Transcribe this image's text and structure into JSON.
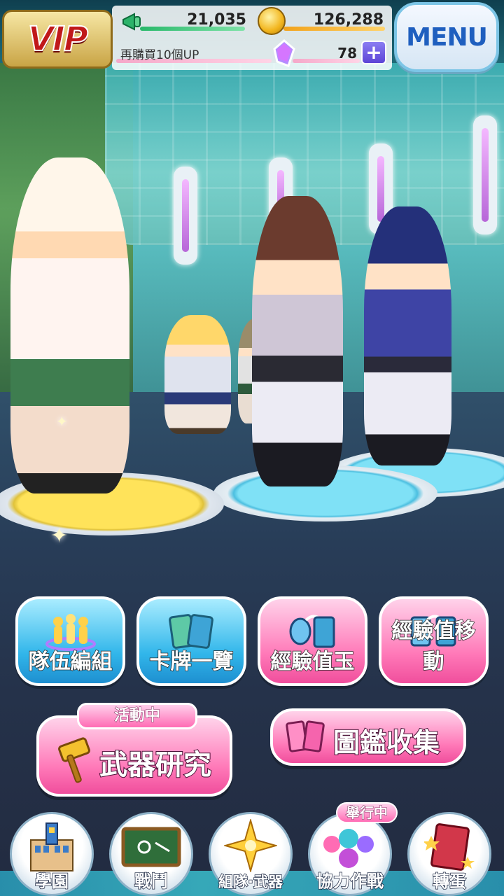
{
  "hud": {
    "vip_label": "VIP",
    "cheer_points": "21,035",
    "coins": "126,288",
    "bonus_text": "再購買10個UP",
    "gems": "78",
    "plus_symbol": "+",
    "menu_label": "MENU"
  },
  "actions": {
    "team_edit": "隊伍編組",
    "card_list": "卡牌一覽",
    "exp_jewel": "經驗值玉",
    "exp_transfer": "經驗值移動"
  },
  "event": {
    "badge": "活動中",
    "weapon_research": "武器研究",
    "collection": "圖鑑收集"
  },
  "nav": {
    "campus": "學園",
    "battle": "戰鬥",
    "team_weapon": "組隊·武器",
    "coop_battle": "協力作戰",
    "gacha": "轉蛋",
    "held_badge": "舉行中"
  },
  "colors": {
    "blue_button": "#31b6ea",
    "pink_button": "#ff79b8",
    "menu_text": "#1f5fbf"
  }
}
